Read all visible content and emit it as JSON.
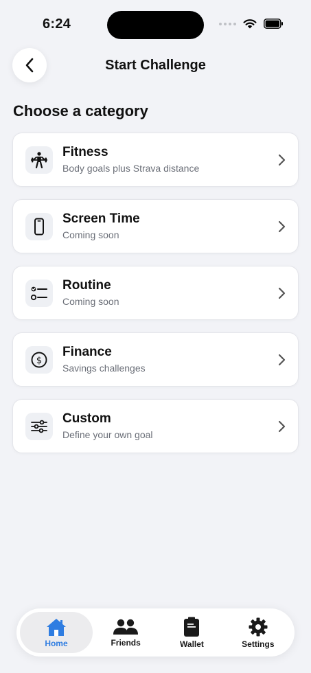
{
  "status": {
    "time": "6:24"
  },
  "header": {
    "title": "Start Challenge"
  },
  "section_title": "Choose a category",
  "categories": [
    {
      "title": "Fitness",
      "subtitle": "Body goals plus Strava distance",
      "icon": "weightlifter-icon"
    },
    {
      "title": "Screen Time",
      "subtitle": "Coming soon",
      "icon": "phone-icon"
    },
    {
      "title": "Routine",
      "subtitle": "Coming soon",
      "icon": "checklist-icon"
    },
    {
      "title": "Finance",
      "subtitle": "Savings challenges",
      "icon": "dollar-icon"
    },
    {
      "title": "Custom",
      "subtitle": "Define your own goal",
      "icon": "sliders-icon"
    }
  ],
  "tabs": [
    {
      "label": "Home",
      "icon": "home-icon",
      "active": true
    },
    {
      "label": "Friends",
      "icon": "friends-icon",
      "active": false
    },
    {
      "label": "Wallet",
      "icon": "wallet-icon",
      "active": false
    },
    {
      "label": "Settings",
      "icon": "gear-icon",
      "active": false
    }
  ],
  "colors": {
    "accent": "#2f7de1",
    "background": "#f2f3f7",
    "card": "#ffffff",
    "subtitle": "#6b6f78"
  }
}
